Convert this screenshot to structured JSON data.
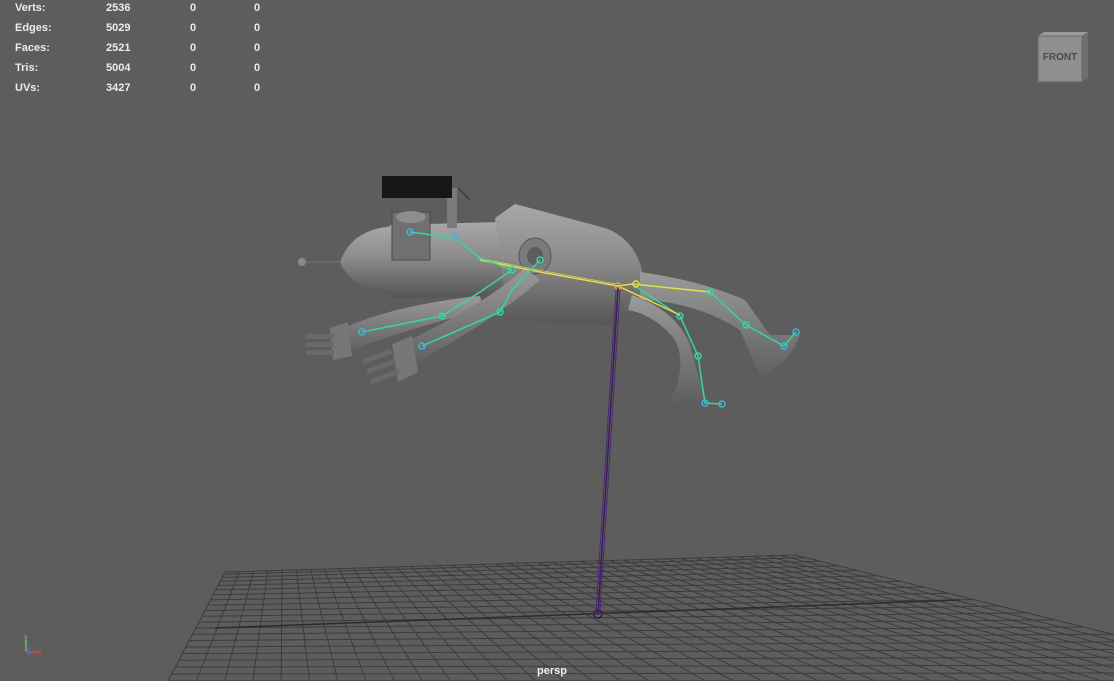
{
  "hud": {
    "rows": [
      {
        "label": "Verts:",
        "total": "2536",
        "selected": "0",
        "component": "0"
      },
      {
        "label": "Edges:",
        "total": "5029",
        "selected": "0",
        "component": "0"
      },
      {
        "label": "Faces:",
        "total": "2521",
        "selected": "0",
        "component": "0"
      },
      {
        "label": "Tris:",
        "total": "5004",
        "selected": "0",
        "component": "0"
      },
      {
        "label": "UVs:",
        "total": "3427",
        "selected": "0",
        "component": "0"
      }
    ]
  },
  "viewcube": {
    "face_label": "FRONT"
  },
  "camera": {
    "name": "persp"
  },
  "axis": {
    "y": "y",
    "z": "z",
    "x": "x"
  },
  "colors": {
    "background": "#5d5d5d",
    "grid": "#3e3e3e",
    "model": "#8a8a8a",
    "joint_green": "#35d6a0",
    "joint_yellow": "#e0e04a",
    "ik_handle": "#3a1a5c"
  }
}
